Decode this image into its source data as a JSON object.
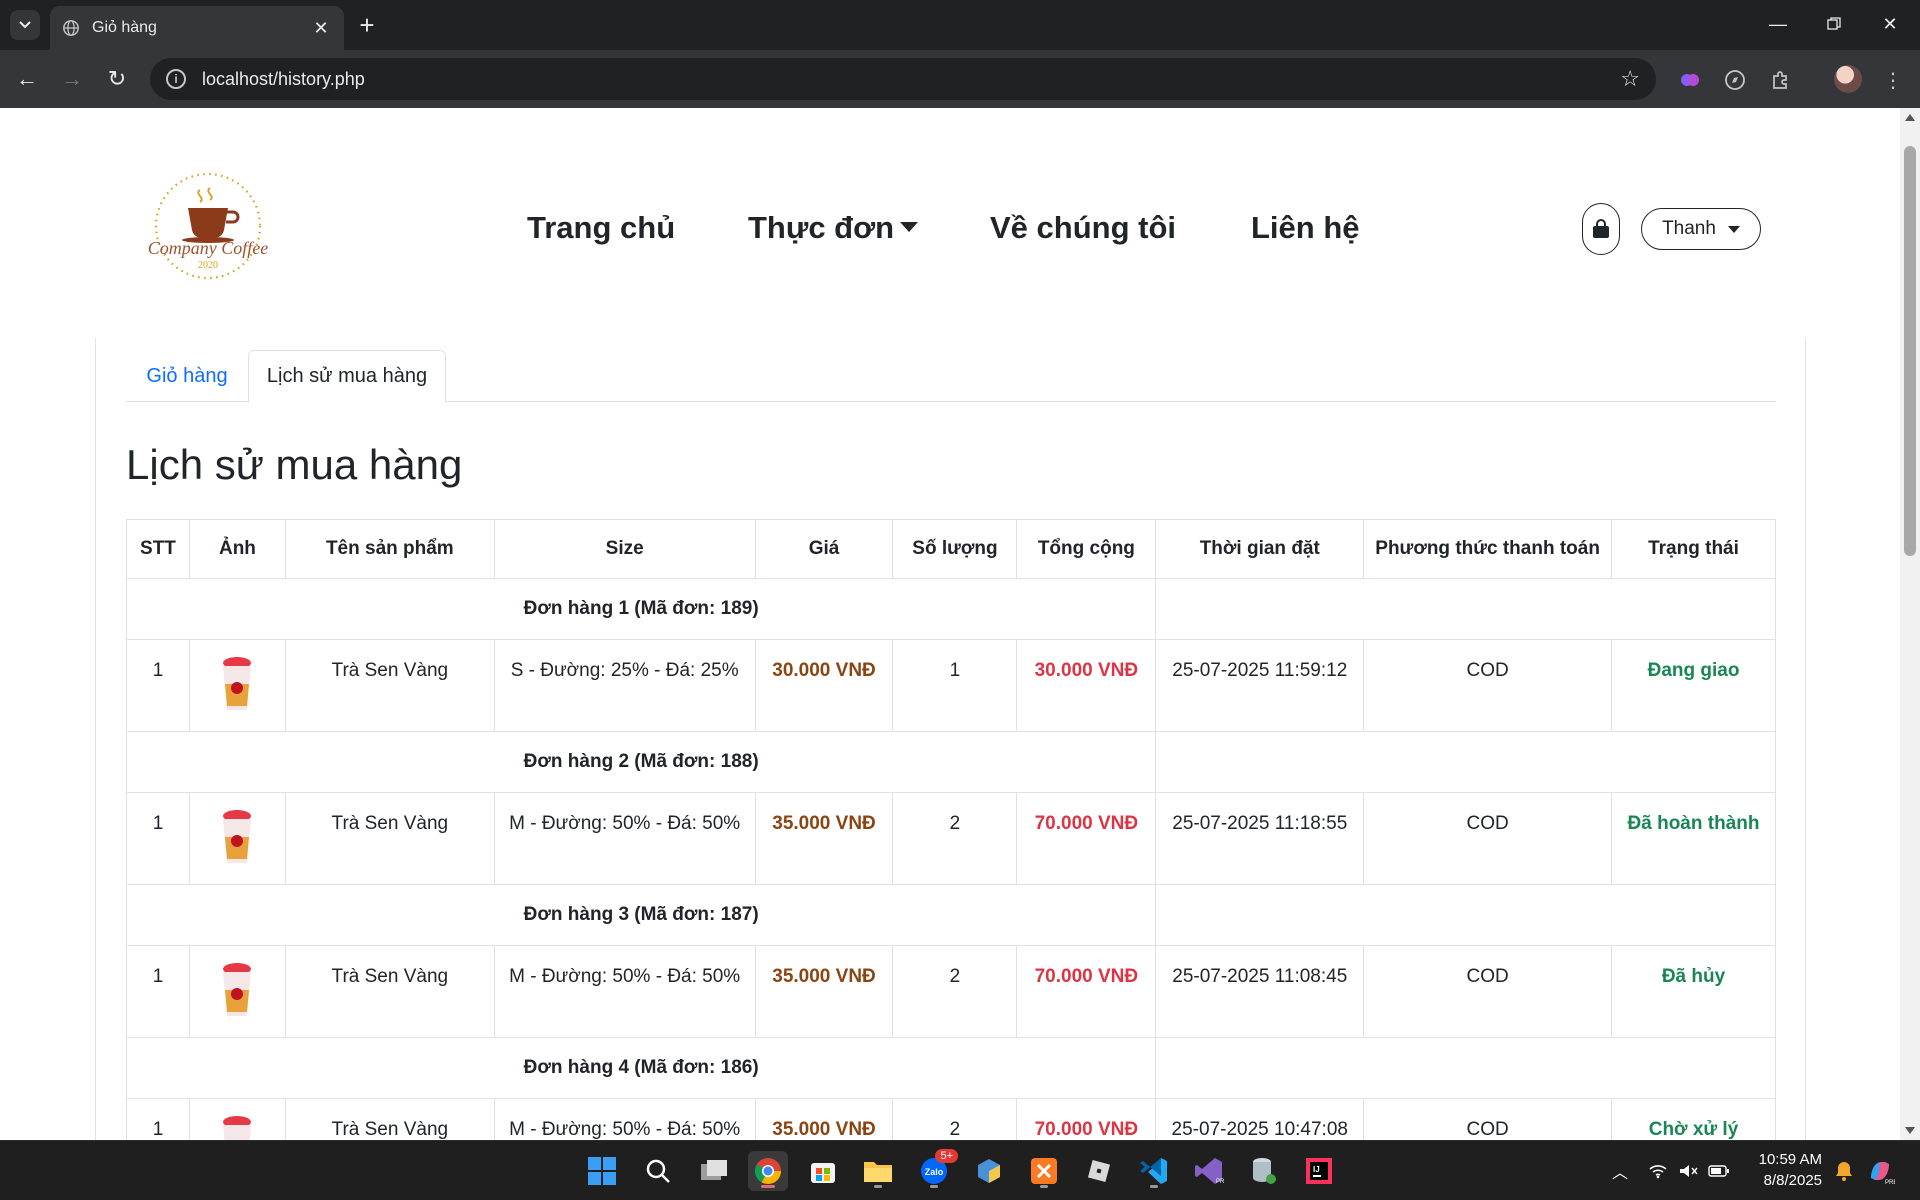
{
  "browser": {
    "tab_title": "Giỏ hàng",
    "url": "localhost/history.php"
  },
  "header": {
    "logo_text": "Company Coffee",
    "logo_year": "2020",
    "nav": {
      "home": "Trang chủ",
      "menu": "Thực đơn",
      "about": "Về chúng tôi",
      "contact": "Liên hệ"
    },
    "user_name": "Thanh"
  },
  "tabs": {
    "cart": "Giỏ hàng",
    "history": "Lịch sử mua hàng"
  },
  "page_title": "Lịch sử mua hàng",
  "table": {
    "headers": [
      "STT",
      "Ảnh",
      "Tên sản phẩm",
      "Size",
      "Giá",
      "Số lượng",
      "Tổng cộng",
      "Thời gian đặt",
      "Phương thức thanh toán",
      "Trạng thái"
    ],
    "orders": [
      {
        "group": "Đơn hàng 1 (Mã đơn: 189)",
        "stt": "1",
        "name": "Trà Sen Vàng",
        "size": "S - Đường: 25% - Đá: 25%",
        "price": "30.000 VNĐ",
        "qty": "1",
        "total": "30.000 VNĐ",
        "time": "25-07-2025 11:59:12",
        "payment": "COD",
        "status": "Đang giao"
      },
      {
        "group": "Đơn hàng 2 (Mã đơn: 188)",
        "stt": "1",
        "name": "Trà Sen Vàng",
        "size": "M - Đường: 50% - Đá: 50%",
        "price": "35.000 VNĐ",
        "qty": "2",
        "total": "70.000 VNĐ",
        "time": "25-07-2025 11:18:55",
        "payment": "COD",
        "status": "Đã hoàn thành"
      },
      {
        "group": "Đơn hàng 3 (Mã đơn: 187)",
        "stt": "1",
        "name": "Trà Sen Vàng",
        "size": "M - Đường: 50% - Đá: 50%",
        "price": "35.000 VNĐ",
        "qty": "2",
        "total": "70.000 VNĐ",
        "time": "25-07-2025 11:08:45",
        "payment": "COD",
        "status": "Đã hủy"
      },
      {
        "group": "Đơn hàng 4 (Mã đơn: 186)",
        "stt": "1",
        "name": "Trà Sen Vàng",
        "size": "M - Đường: 50% - Đá: 50%",
        "price": "35.000 VNĐ",
        "qty": "2",
        "total": "70.000 VNĐ",
        "time": "25-07-2025 10:47:08",
        "payment": "COD",
        "status": "Chờ xử lý"
      }
    ]
  },
  "colors": {
    "price": "#8b4513",
    "total": "#dc3545",
    "status": "#198754",
    "link": "#0d6efd"
  },
  "taskbar": {
    "zalo_badge": "5+",
    "time": "10:59 AM",
    "date": "8/8/2025"
  }
}
